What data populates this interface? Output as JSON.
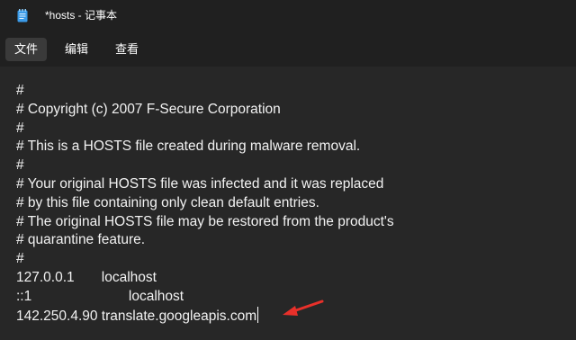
{
  "window": {
    "title": "*hosts - 记事本",
    "app_icon": "notepad-icon"
  },
  "menu": {
    "file_label": "文件",
    "edit_label": "编辑",
    "view_label": "查看"
  },
  "editor": {
    "lines": [
      "#",
      "# Copyright (c) 2007 F-Secure Corporation",
      "#",
      "# This is a HOSTS file created during malware removal.",
      "#",
      "# Your original HOSTS file was infected and it was replaced",
      "# by this file containing only clean default entries.",
      "# The original HOSTS file may be restored from the product's",
      "# quarantine feature.",
      "#",
      "127.0.0.1       localhost",
      "::1                         localhost",
      "142.250.4.90 translate.googleapis.com"
    ]
  },
  "annotation": {
    "arrow_icon": "red-arrow-icon",
    "arrow_color": "#e8302a"
  },
  "colors": {
    "background": "#272727",
    "titlebar": "#202020",
    "text": "#f2f2f2"
  }
}
